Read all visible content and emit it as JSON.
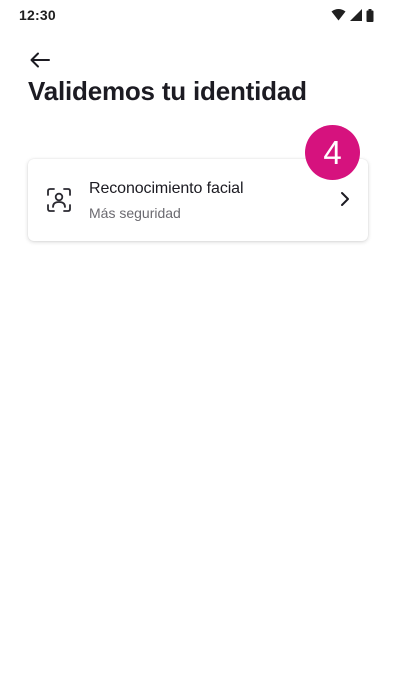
{
  "status_bar": {
    "time": "12:30",
    "icons": [
      "wifi-icon",
      "cellular-signal-icon",
      "battery-icon"
    ]
  },
  "header": {
    "back_icon": "arrow-left-icon",
    "title": "Validemos tu identidad"
  },
  "options": [
    {
      "icon": "face-recognition-icon",
      "title": "Reconocimiento facial",
      "subtitle": "Más seguridad",
      "chevron": "chevron-right-icon"
    }
  ],
  "step_badge": {
    "number": "4",
    "color": "#d6127e"
  },
  "colors": {
    "text_primary": "#1c1b22",
    "text_secondary": "#6b6a70",
    "accent": "#d6127e",
    "background": "#ffffff"
  }
}
